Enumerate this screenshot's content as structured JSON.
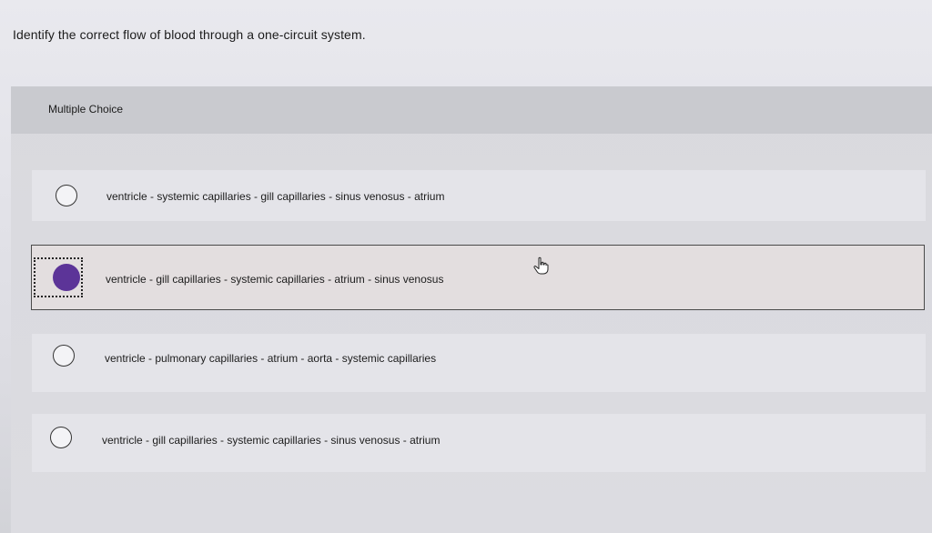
{
  "question": {
    "text": "Identify the correct flow of blood through a one-circuit system."
  },
  "panel": {
    "header_label": "Multiple Choice"
  },
  "options": [
    {
      "label": "ventricle - systemic capillaries - gill capillaries - sinus venosus - atrium",
      "selected": false
    },
    {
      "label": "ventricle - gill capillaries - systemic capillaries - atrium - sinus venosus",
      "selected": true
    },
    {
      "label": "ventricle - pulmonary capillaries - atrium - aorta - systemic capillaries",
      "selected": false
    },
    {
      "label": "ventricle - gill capillaries - systemic capillaries - sinus venosus - atrium",
      "selected": false
    }
  ],
  "colors": {
    "selected_radio": "#5c3498",
    "selected_border": "#4a4a4a"
  },
  "icons": {
    "cursor": "hand-pointer-icon"
  }
}
